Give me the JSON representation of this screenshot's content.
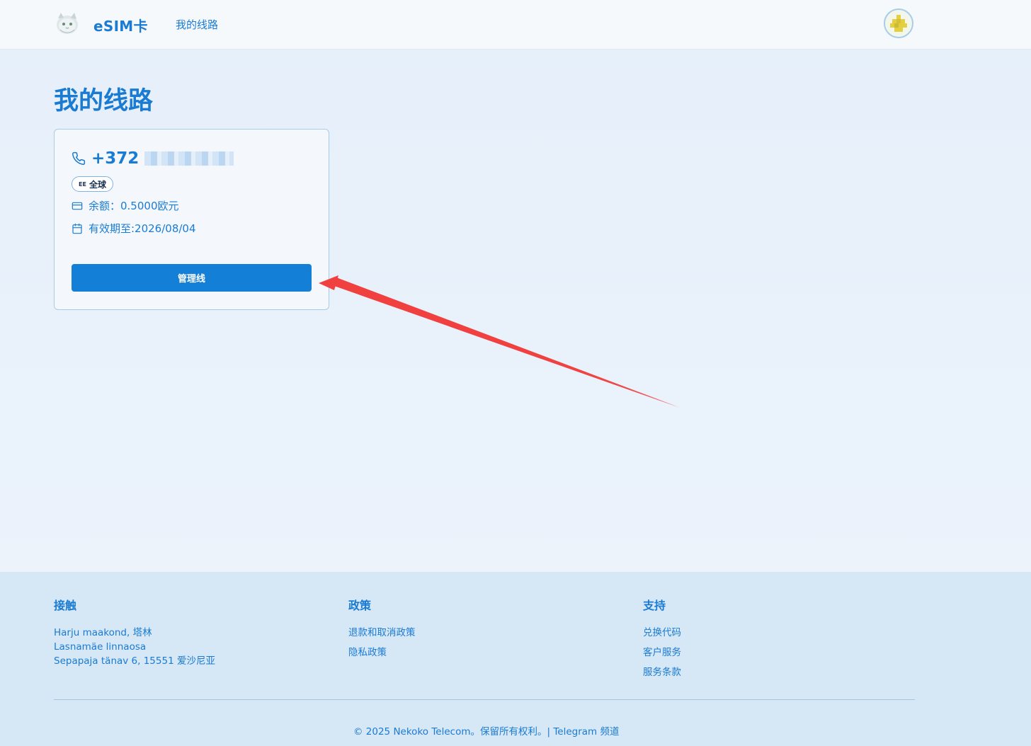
{
  "header": {
    "brand": "eSIM卡",
    "nav": {
      "my_lines": "我的线路"
    }
  },
  "main": {
    "title": "我的线路",
    "line_card": {
      "phone_number": "+372",
      "badge_country_code": "EE",
      "badge_label": "全球",
      "balance": "余额：0.5000欧元",
      "expiry": "有效期至:2026/08/04",
      "manage_button": "管理线"
    }
  },
  "footer": {
    "contact": {
      "heading": "接触",
      "address": [
        "Harju maakond, 塔林",
        "Lasnamäe linnaosa",
        "Sepapaja tänav 6, 15551 爱沙尼亚"
      ]
    },
    "policy": {
      "heading": "政策",
      "links": [
        "退款和取消政策",
        "隐私政策"
      ]
    },
    "support": {
      "heading": "支持",
      "links": [
        "兑换代码",
        "客户服务",
        "服务条款"
      ]
    },
    "copyright": "© 2025 Nekoko Telecom。保留所有权利。|",
    "telegram_link": "Telegram 频道"
  },
  "colors": {
    "primary": "#1a7bd3",
    "button": "#137fd6",
    "annotation_arrow": "#f04040"
  },
  "icons": {
    "logo": "cat-logo-icon",
    "avatar": "pixel-avatar-icon",
    "phone": "phone-icon",
    "balance": "credit-card-icon",
    "expiry": "calendar-icon"
  }
}
